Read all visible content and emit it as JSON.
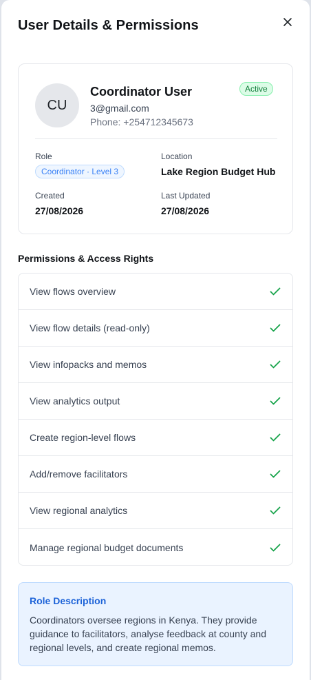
{
  "header": {
    "title": "User Details & Permissions",
    "close_icon": "close-icon"
  },
  "user": {
    "initials": "CU",
    "name": "Coordinator User",
    "email": "3@gmail.com",
    "phone": "Phone: +254712345673",
    "status": "Active"
  },
  "details": {
    "role_label": "Role",
    "role_value": "Coordinator · Level 3",
    "location_label": "Location",
    "location_value": "Lake Region Budget Hub",
    "created_label": "Created",
    "created_value": "27/08/2026",
    "updated_label": "Last Updated",
    "updated_value": "27/08/2026"
  },
  "permissions": {
    "title": "Permissions & Access Rights",
    "items": [
      {
        "label": "View flows overview",
        "granted": true
      },
      {
        "label": "View flow details (read-only)",
        "granted": true
      },
      {
        "label": "View infopacks and memos",
        "granted": true
      },
      {
        "label": "View analytics output",
        "granted": true
      },
      {
        "label": "Create region-level flows",
        "granted": true
      },
      {
        "label": "Add/remove facilitators",
        "granted": true
      },
      {
        "label": "View regional analytics",
        "granted": true
      },
      {
        "label": "Manage regional budget documents",
        "granted": true
      }
    ]
  },
  "role_description": {
    "title": "Role Description",
    "text": "Coordinators oversee regions in Kenya. They provide guidance to facilitators, analyse feedback at county and regional levels, and create regional memos."
  },
  "colors": {
    "accent": "#1d63d8",
    "success": "#16a34a",
    "border": "#e5e7eb"
  }
}
